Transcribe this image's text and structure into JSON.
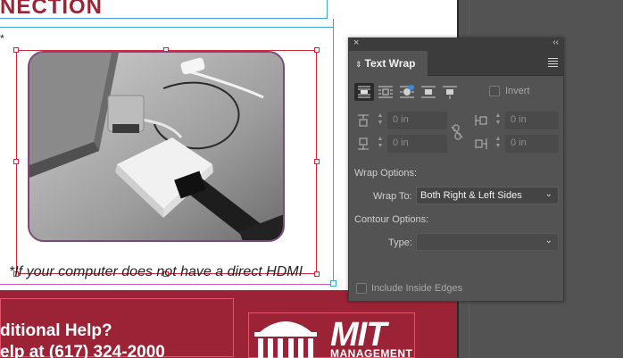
{
  "document": {
    "heading": "NECTION",
    "asterisk": "*",
    "caption": "*If your computer does not have a direct HDMI",
    "footer_line1": "ditional Help?",
    "footer_line2": "elp at (617) 324-2000",
    "logo_text": "MIT",
    "logo_sub": "MANAGEMENT"
  },
  "panel": {
    "tab_title": "Text Wrap",
    "close_glyph": "×",
    "collapse_glyph": "‹‹",
    "wrap_buttons": [
      {
        "name": "no-text-wrap",
        "active": true
      },
      {
        "name": "wrap-around-bounding-box",
        "active": false
      },
      {
        "name": "wrap-around-object-shape",
        "active": false
      },
      {
        "name": "jump-object",
        "active": false
      },
      {
        "name": "jump-to-next-column",
        "active": false
      }
    ],
    "invert_label": "Invert",
    "offsets": {
      "top": "0 in",
      "bottom": "0 in",
      "left": "0 in",
      "right": "0 in"
    },
    "wrap_options_label": "Wrap Options:",
    "wrap_to_label": "Wrap To:",
    "wrap_to_value": "Both Right & Left Sides",
    "contour_options_label": "Contour Options:",
    "type_label": "Type:",
    "type_value": "",
    "include_inside_edges_label": "Include Inside Edges"
  },
  "colors": {
    "brand_red": "#9b2335",
    "panel_bg": "#535353",
    "frame_red": "#d0283c"
  }
}
